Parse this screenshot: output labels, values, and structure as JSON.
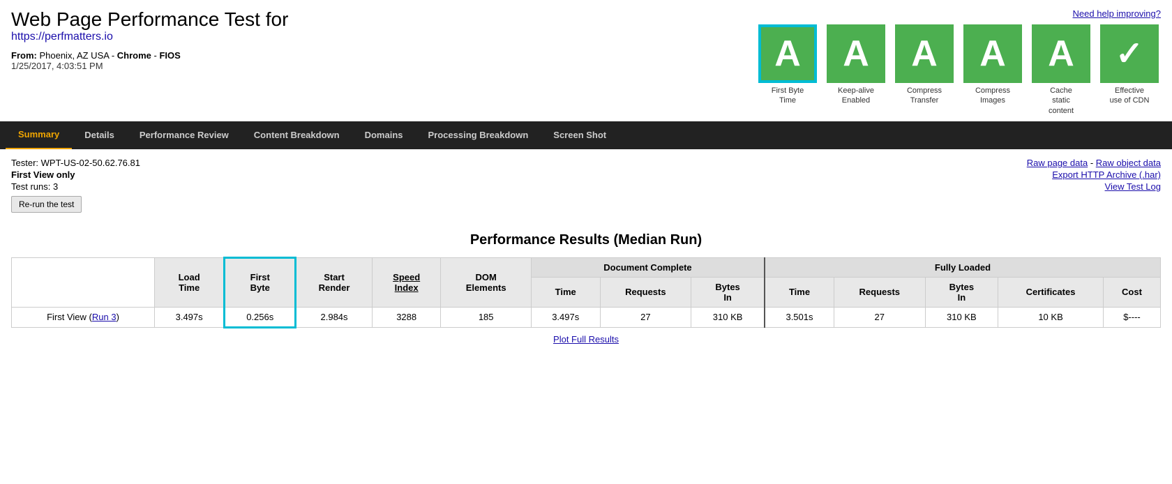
{
  "header": {
    "title": "Web Page Performance Test for",
    "url": "https://perfmatters.io",
    "from_label": "From:",
    "from_value": "Phoenix, AZ USA",
    "browser": "Chrome",
    "connection": "FIOS",
    "datetime": "1/25/2017, 4:03:51 PM",
    "need_help": "Need help improving?"
  },
  "grades": [
    {
      "id": "first-byte",
      "letter": "A",
      "label": "First Byte\nTime",
      "selected": true
    },
    {
      "id": "keep-alive",
      "letter": "A",
      "label": "Keep-alive\nEnabled",
      "selected": false
    },
    {
      "id": "compress-transfer",
      "letter": "A",
      "label": "Compress\nTransfer",
      "selected": false
    },
    {
      "id": "compress-images",
      "letter": "A",
      "label": "Compress\nImages",
      "selected": false
    },
    {
      "id": "cache-static",
      "letter": "A",
      "label": "Cache\nstatic\ncontent",
      "selected": false
    },
    {
      "id": "cdn",
      "letter": "✓",
      "label": "Effective\nuse of CDN",
      "selected": false
    }
  ],
  "nav": {
    "items": [
      {
        "id": "summary",
        "label": "Summary",
        "active": true
      },
      {
        "id": "details",
        "label": "Details",
        "active": false
      },
      {
        "id": "performance-review",
        "label": "Performance Review",
        "active": false
      },
      {
        "id": "content-breakdown",
        "label": "Content Breakdown",
        "active": false
      },
      {
        "id": "domains",
        "label": "Domains",
        "active": false
      },
      {
        "id": "processing-breakdown",
        "label": "Processing Breakdown",
        "active": false
      },
      {
        "id": "screen-shot",
        "label": "Screen Shot",
        "active": false
      }
    ]
  },
  "info": {
    "tester": "Tester: WPT-US-02-50.62.76.81",
    "first_view": "First View only",
    "test_runs": "Test runs: 3",
    "rerun_label": "Re-run the test",
    "raw_page_data": "Raw page data",
    "raw_object_data": "Raw object data",
    "export_har": "Export HTTP Archive (.har)",
    "view_test_log": "View Test Log"
  },
  "results": {
    "title": "Performance Results (Median Run)",
    "columns": {
      "load_time": "Load\nTime",
      "first_byte": "First\nByte",
      "start_render": "Start\nRender",
      "speed_index": "Speed\nIndex",
      "dom_elements": "DOM\nElements",
      "doc_complete": "Document Complete",
      "doc_time": "Time",
      "doc_requests": "Requests",
      "doc_bytes_in": "Bytes\nIn",
      "fully_loaded": "Fully Loaded",
      "fl_time": "Time",
      "fl_requests": "Requests",
      "fl_bytes_in": "Bytes\nIn",
      "fl_certificates": "Certificates",
      "fl_cost": "Cost"
    },
    "rows": [
      {
        "label": "First View (Run 3)",
        "run_link": "Run 3",
        "load_time": "3.497s",
        "first_byte": "0.256s",
        "start_render": "2.984s",
        "speed_index": "3288",
        "dom_elements": "185",
        "doc_time": "3.497s",
        "doc_requests": "27",
        "doc_bytes_in": "310 KB",
        "fl_time": "3.501s",
        "fl_requests": "27",
        "fl_bytes_in": "310 KB",
        "fl_certificates": "10 KB",
        "fl_cost": "$----"
      }
    ],
    "plot_link": "Plot Full Results"
  }
}
